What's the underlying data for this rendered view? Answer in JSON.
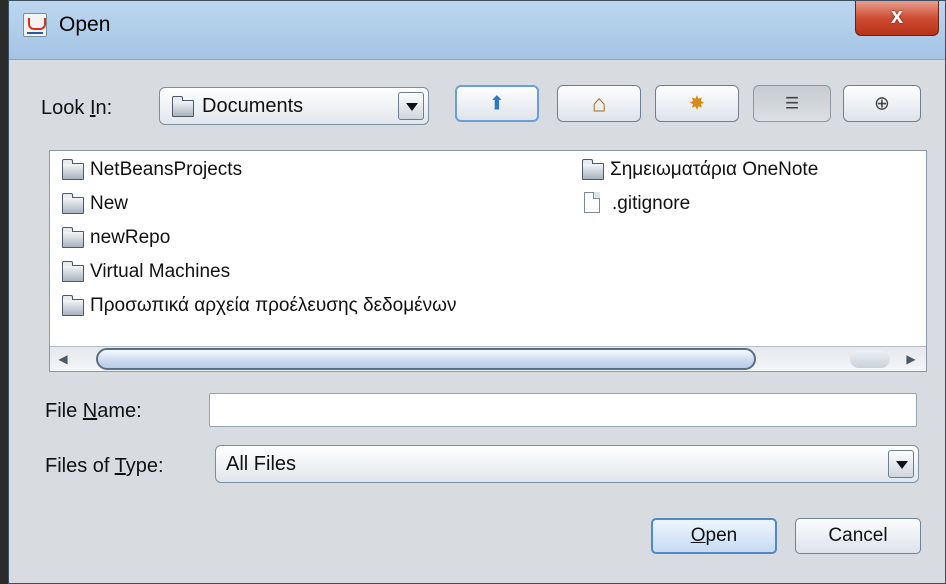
{
  "window": {
    "title": "Open",
    "close_glyph": "x"
  },
  "look_in": {
    "label_before": "Look ",
    "label_mnemonic": "I",
    "label_after": "n:",
    "selected": "Documents",
    "icon": "folder-icon"
  },
  "toolbar": [
    {
      "name": "up-one-level-button",
      "icon": "folder-up-icon",
      "glyph": "⬆"
    },
    {
      "name": "home-button",
      "icon": "home-icon",
      "glyph": "⌂"
    },
    {
      "name": "new-folder-button",
      "icon": "new-folder-icon",
      "glyph": "✸"
    },
    {
      "name": "list-view-button",
      "icon": "list-view-icon",
      "glyph": "☰"
    },
    {
      "name": "details-view-button",
      "icon": "details-view-icon",
      "glyph": "⊕"
    }
  ],
  "files": [
    {
      "name": "NetBeansProjects",
      "type": "folder"
    },
    {
      "name": "New",
      "type": "folder"
    },
    {
      "name": "newRepo",
      "type": "folder"
    },
    {
      "name": "Virtual Machines",
      "type": "folder"
    },
    {
      "name": "Προσωπικά αρχεία προέλευσης δεδομένων",
      "type": "folder"
    },
    {
      "name": "Σημειωματάρια OneNote",
      "type": "folder"
    },
    {
      "name": ".gitignore",
      "type": "file"
    }
  ],
  "file_name": {
    "label_before": "File ",
    "label_mnemonic": "N",
    "label_after": "ame:",
    "value": ""
  },
  "file_type": {
    "label_before": "Files of ",
    "label_mnemonic": "T",
    "label_after": "ype:",
    "selected": "All Files"
  },
  "buttons": {
    "open_mnemonic": "O",
    "open_rest": "pen",
    "cancel": "Cancel"
  },
  "colors": {
    "titlebar": "#b5d0ec",
    "close_button": "#c8452c",
    "dialog_bg": "#d8dce1",
    "default_button_border": "#4f89c6"
  }
}
